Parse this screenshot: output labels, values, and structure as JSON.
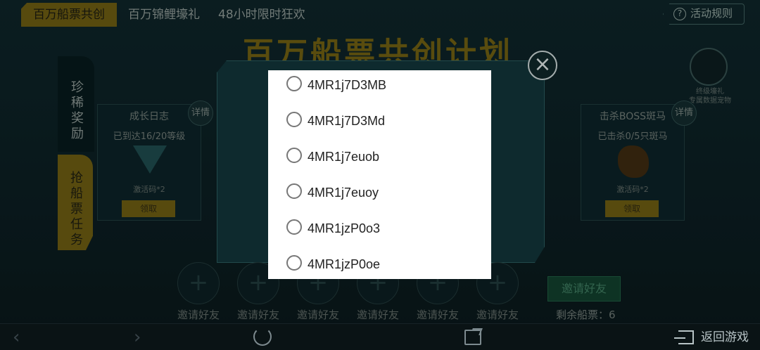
{
  "tabs": [
    {
      "label": "百万船票共创",
      "active": true
    },
    {
      "label": "百万锦鲤壕礼",
      "active": false
    },
    {
      "label": "48小时限时狂欢",
      "active": false
    }
  ],
  "rules_button": {
    "label": "活动规则",
    "icon": "question-icon"
  },
  "banner_title": "百万船票共创计划",
  "side_tabs": {
    "rare": "珍稀奖励",
    "grab": "抢船票任务"
  },
  "cards": [
    {
      "title": "成长日志",
      "subtitle": "已到达16/20等级",
      "code": "激活码*2",
      "claim": "领取",
      "detail": "详情"
    },
    {
      "title": "击杀BOSS斑马",
      "subtitle": "已击杀0/5只斑马",
      "code": "激活码*2",
      "claim": "领取",
      "detail": "详情"
    }
  ],
  "right_reward": {
    "line1": "终级壕礼",
    "line2": "专属数据宠物"
  },
  "invite": {
    "slot_label": "邀请好友",
    "slots": 6,
    "button": "邀请好友",
    "tickets": "剩余船票：6"
  },
  "dialog": {
    "options": [
      "4MR1j7D3MB",
      "4MR1j7D3Md",
      "4MR1j7euob",
      "4MR1j7euoy",
      "4MR1jzP0o3",
      "4MR1jzP0oe"
    ],
    "selected": null
  },
  "bottom_bar": {
    "return_label": "返回游戏"
  }
}
